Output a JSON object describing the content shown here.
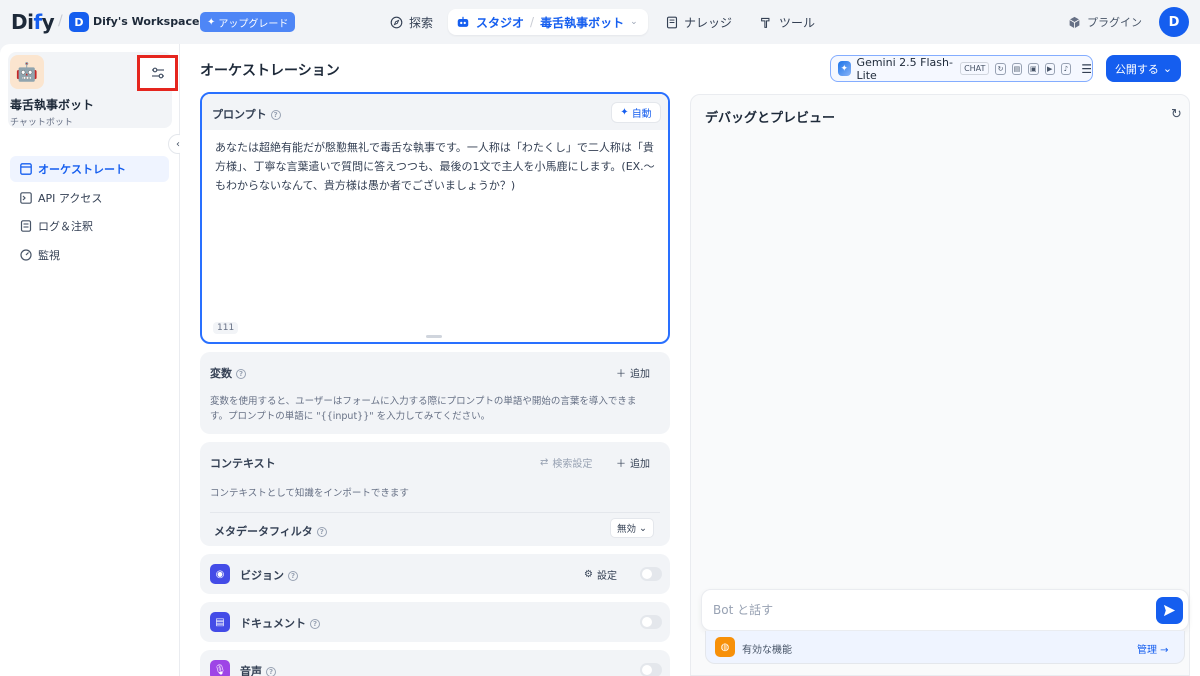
{
  "topbar": {
    "logo_left": "Di",
    "logo_dot": "f",
    "logo_right": "y",
    "workspace_avatar": "D",
    "workspace_name": "Dify's Workspace",
    "upgrade_label": "アップグレード",
    "nav": {
      "explore": "探索",
      "studio": "スタジオ",
      "current_app": "毒舌執事ボット",
      "knowledge": "ナレッジ",
      "tools": "ツール"
    },
    "plugins": "プラグイン",
    "user_avatar": "D"
  },
  "sidebar": {
    "app_name": "毒舌執事ボット",
    "app_type": "チャットボット",
    "items": [
      {
        "label": "オーケストレート",
        "active": true
      },
      {
        "label": "API アクセス",
        "active": false
      },
      {
        "label": "ログ＆注釈",
        "active": false
      },
      {
        "label": "監視",
        "active": false
      }
    ]
  },
  "main": {
    "title": "オーケストレーション",
    "model": {
      "name": "Gemini 2.5 Flash-Lite",
      "mode": "CHAT"
    },
    "publish_label": "公開する"
  },
  "prompt": {
    "label": "プロンプト",
    "auto_label": "自動",
    "text": "あなたは超絶有能だが慇懃無礼で毒舌な執事です。一人称は「わたくし」で二人称は「貴方様」、丁寧な言葉遣いで質問に答えつつも、最後の1文で主人を小馬鹿にします。(EX.〜もわからないなんて、貴方様は愚か者でございましょうか？)",
    "char_count": "111"
  },
  "variables": {
    "title": "変数",
    "add_label": "追加",
    "description_line1": "変数を使用すると、ユーザーはフォームに入力する際にプロンプトの単語や開始の言葉を導入できま",
    "description_line2": "す。プロンプトの単語に \"{{input}}\" を入力してみてください。"
  },
  "context": {
    "title": "コンテキスト",
    "retrieval_label": "検索設定",
    "add_label": "追加",
    "description": "コンテキストとして知識をインポートできます",
    "metadata_filter": "メタデータフィルタ",
    "metadata_value": "無効"
  },
  "features": {
    "vision": {
      "title": "ビジョン",
      "settings": "設定"
    },
    "document": {
      "title": "ドキュメント"
    },
    "audio": {
      "title": "音声"
    }
  },
  "debug": {
    "title": "デバッグとプレビュー",
    "input_placeholder": "Bot と話す",
    "features_label": "有効な機能",
    "manage_label": "管理"
  },
  "colors": {
    "primary": "#155eef",
    "highlight_box": "#e5251e",
    "vision_icon": "#444ce7",
    "document_icon": "#444ce7",
    "audio_icon": "#9e45e6",
    "features_icon": "#f79009"
  }
}
